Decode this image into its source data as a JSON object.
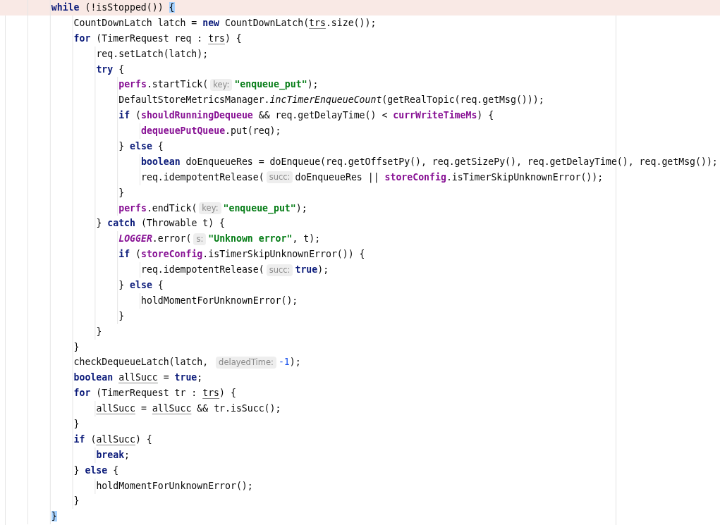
{
  "editor": {
    "lines": [
      {
        "current": true,
        "segments": [
          {
            "kind": "code",
            "tokens": [
              {
                "text": "    while",
                "kind": "kw"
              },
              {
                "text": " (!isStopped()) ",
                "kind": "plain"
              },
              {
                "text": "{",
                "kind": "brace"
              }
            ]
          }
        ]
      },
      {
        "current": false,
        "segments": [
          {
            "kind": "code",
            "tokens": [
              {
                "text": "        CountDownLatch latch = ",
                "kind": "plain"
              },
              {
                "text": "new",
                "kind": "kw"
              },
              {
                "text": " CountDownLatch(",
                "kind": "plain"
              },
              {
                "text": "trs",
                "kind": "var"
              },
              {
                "text": ".size());",
                "kind": "plain"
              }
            ]
          }
        ]
      },
      {
        "current": false,
        "segments": [
          {
            "kind": "code",
            "tokens": [
              {
                "text": "        for",
                "kind": "kw"
              },
              {
                "text": " (TimerRequest req : ",
                "kind": "plain"
              },
              {
                "text": "trs",
                "kind": "var"
              },
              {
                "text": ") {",
                "kind": "plain"
              }
            ]
          }
        ]
      },
      {
        "current": false,
        "segments": [
          {
            "kind": "code",
            "tokens": [
              {
                "text": "            req.setLatch(latch);",
                "kind": "plain"
              }
            ]
          }
        ]
      },
      {
        "current": false,
        "segments": [
          {
            "kind": "code",
            "tokens": [
              {
                "text": "            try",
                "kind": "kw"
              },
              {
                "text": " {",
                "kind": "plain"
              }
            ]
          }
        ]
      },
      {
        "current": false,
        "segments": [
          {
            "kind": "code",
            "tokens": [
              {
                "text": "                perfs",
                "kind": "field"
              },
              {
                "text": ".startTick(",
                "kind": "plain"
              }
            ]
          },
          {
            "kind": "hint",
            "text": "key:"
          },
          {
            "kind": "code",
            "tokens": [
              {
                "text": "\"enqueue_put\"",
                "kind": "str"
              },
              {
                "text": ");",
                "kind": "plain"
              }
            ]
          }
        ]
      },
      {
        "current": false,
        "segments": [
          {
            "kind": "code",
            "tokens": [
              {
                "text": "                DefaultStoreMetricsManager.",
                "kind": "plain"
              },
              {
                "text": "incTimerEnqueueCount",
                "kind": "static"
              },
              {
                "text": "(getRealTopic(req.getMsg()));",
                "kind": "plain"
              }
            ]
          }
        ]
      },
      {
        "current": false,
        "segments": [
          {
            "kind": "code",
            "tokens": [
              {
                "text": "                if",
                "kind": "kw"
              },
              {
                "text": " (",
                "kind": "plain"
              },
              {
                "text": "shouldRunningDequeue",
                "kind": "field"
              },
              {
                "text": " && req.getDelayTime() < ",
                "kind": "plain"
              },
              {
                "text": "currWriteTimeMs",
                "kind": "field"
              },
              {
                "text": ") {",
                "kind": "plain"
              }
            ]
          }
        ]
      },
      {
        "current": false,
        "segments": [
          {
            "kind": "code",
            "tokens": [
              {
                "text": "                    dequeuePutQueue",
                "kind": "field"
              },
              {
                "text": ".put(req);",
                "kind": "plain"
              }
            ]
          }
        ]
      },
      {
        "current": false,
        "segments": [
          {
            "kind": "code",
            "tokens": [
              {
                "text": "                } ",
                "kind": "plain"
              },
              {
                "text": "else",
                "kind": "kw"
              },
              {
                "text": " {",
                "kind": "plain"
              }
            ]
          }
        ]
      },
      {
        "current": false,
        "segments": [
          {
            "kind": "code",
            "tokens": [
              {
                "text": "                    boolean",
                "kind": "kw"
              },
              {
                "text": " doEnqueueRes = doEnqueue(req.getOffsetPy(), req.getSizePy(), req.getDelayTime(), req.getMsg());",
                "kind": "plain"
              }
            ]
          }
        ]
      },
      {
        "current": false,
        "segments": [
          {
            "kind": "code",
            "tokens": [
              {
                "text": "                    req.idempotentRelease(",
                "kind": "plain"
              }
            ]
          },
          {
            "kind": "hint",
            "text": "succ:"
          },
          {
            "kind": "code",
            "tokens": [
              {
                "text": "doEnqueueRes || ",
                "kind": "plain"
              },
              {
                "text": "storeConfig",
                "kind": "field"
              },
              {
                "text": ".isTimerSkipUnknownError());",
                "kind": "plain"
              }
            ]
          }
        ]
      },
      {
        "current": false,
        "segments": [
          {
            "kind": "code",
            "tokens": [
              {
                "text": "                }",
                "kind": "plain"
              }
            ]
          }
        ]
      },
      {
        "current": false,
        "segments": [
          {
            "kind": "code",
            "tokens": [
              {
                "text": "                perfs",
                "kind": "field"
              },
              {
                "text": ".endTick(",
                "kind": "plain"
              }
            ]
          },
          {
            "kind": "hint",
            "text": "key:"
          },
          {
            "kind": "code",
            "tokens": [
              {
                "text": "\"enqueue_put\"",
                "kind": "str"
              },
              {
                "text": ");",
                "kind": "plain"
              }
            ]
          }
        ]
      },
      {
        "current": false,
        "segments": [
          {
            "kind": "code",
            "tokens": [
              {
                "text": "            } ",
                "kind": "plain"
              },
              {
                "text": "catch",
                "kind": "kw"
              },
              {
                "text": " (Throwable t) {",
                "kind": "plain"
              }
            ]
          }
        ]
      },
      {
        "current": false,
        "segments": [
          {
            "kind": "code",
            "tokens": [
              {
                "text": "                LOGGER",
                "kind": "staticfield"
              },
              {
                "text": ".error(",
                "kind": "plain"
              }
            ]
          },
          {
            "kind": "hint",
            "text": "s:"
          },
          {
            "kind": "code",
            "tokens": [
              {
                "text": "\"Unknown error\"",
                "kind": "str"
              },
              {
                "text": ", t);",
                "kind": "plain"
              }
            ]
          }
        ]
      },
      {
        "current": false,
        "segments": [
          {
            "kind": "code",
            "tokens": [
              {
                "text": "                if",
                "kind": "kw"
              },
              {
                "text": " (",
                "kind": "plain"
              },
              {
                "text": "storeConfig",
                "kind": "field"
              },
              {
                "text": ".isTimerSkipUnknownError()) {",
                "kind": "plain"
              }
            ]
          }
        ]
      },
      {
        "current": false,
        "segments": [
          {
            "kind": "code",
            "tokens": [
              {
                "text": "                    req.idempotentRelease(",
                "kind": "plain"
              }
            ]
          },
          {
            "kind": "hint",
            "text": "succ:"
          },
          {
            "kind": "code",
            "tokens": [
              {
                "text": "true",
                "kind": "kw"
              },
              {
                "text": ");",
                "kind": "plain"
              }
            ]
          }
        ]
      },
      {
        "current": false,
        "segments": [
          {
            "kind": "code",
            "tokens": [
              {
                "text": "                } ",
                "kind": "plain"
              },
              {
                "text": "else",
                "kind": "kw"
              },
              {
                "text": " {",
                "kind": "plain"
              }
            ]
          }
        ]
      },
      {
        "current": false,
        "segments": [
          {
            "kind": "code",
            "tokens": [
              {
                "text": "                    holdMomentForUnknownError();",
                "kind": "plain"
              }
            ]
          }
        ]
      },
      {
        "current": false,
        "segments": [
          {
            "kind": "code",
            "tokens": [
              {
                "text": "                }",
                "kind": "plain"
              }
            ]
          }
        ]
      },
      {
        "current": false,
        "segments": [
          {
            "kind": "code",
            "tokens": [
              {
                "text": "            }",
                "kind": "plain"
              }
            ]
          }
        ]
      },
      {
        "current": false,
        "segments": [
          {
            "kind": "code",
            "tokens": [
              {
                "text": "        }",
                "kind": "plain"
              }
            ]
          }
        ]
      },
      {
        "current": false,
        "segments": [
          {
            "kind": "code",
            "tokens": [
              {
                "text": "        checkDequeueLatch(latch, ",
                "kind": "plain"
              }
            ]
          },
          {
            "kind": "hint",
            "text": "delayedTime:"
          },
          {
            "kind": "code",
            "tokens": [
              {
                "text": "-1",
                "kind": "num"
              },
              {
                "text": ");",
                "kind": "plain"
              }
            ]
          }
        ]
      },
      {
        "current": false,
        "segments": [
          {
            "kind": "code",
            "tokens": [
              {
                "text": "        boolean ",
                "kind": "kw"
              },
              {
                "text": "allSucc",
                "kind": "varwarn"
              },
              {
                "text": " = ",
                "kind": "plain"
              },
              {
                "text": "true",
                "kind": "kw"
              },
              {
                "text": ";",
                "kind": "plain"
              }
            ]
          }
        ]
      },
      {
        "current": false,
        "segments": [
          {
            "kind": "code",
            "tokens": [
              {
                "text": "        for",
                "kind": "kw"
              },
              {
                "text": " (TimerRequest tr : ",
                "kind": "plain"
              },
              {
                "text": "trs",
                "kind": "var"
              },
              {
                "text": ") {",
                "kind": "plain"
              }
            ]
          }
        ]
      },
      {
        "current": false,
        "segments": [
          {
            "kind": "code",
            "tokens": [
              {
                "text": "            allSucc",
                "kind": "var"
              },
              {
                "text": " = ",
                "kind": "plain"
              },
              {
                "text": "allSucc",
                "kind": "var"
              },
              {
                "text": " && tr.isSucc();",
                "kind": "plain"
              }
            ]
          }
        ]
      },
      {
        "current": false,
        "segments": [
          {
            "kind": "code",
            "tokens": [
              {
                "text": "        }",
                "kind": "plain"
              }
            ]
          }
        ]
      },
      {
        "current": false,
        "segments": [
          {
            "kind": "code",
            "tokens": [
              {
                "text": "        if",
                "kind": "kw"
              },
              {
                "text": " (",
                "kind": "plain"
              },
              {
                "text": "allSucc",
                "kind": "var"
              },
              {
                "text": ") {",
                "kind": "plain"
              }
            ]
          }
        ]
      },
      {
        "current": false,
        "segments": [
          {
            "kind": "code",
            "tokens": [
              {
                "text": "            break",
                "kind": "kw"
              },
              {
                "text": ";",
                "kind": "plain"
              }
            ]
          }
        ]
      },
      {
        "current": false,
        "segments": [
          {
            "kind": "code",
            "tokens": [
              {
                "text": "        } ",
                "kind": "plain"
              },
              {
                "text": "else",
                "kind": "kw"
              },
              {
                "text": " {",
                "kind": "plain"
              }
            ]
          }
        ]
      },
      {
        "current": false,
        "segments": [
          {
            "kind": "code",
            "tokens": [
              {
                "text": "            holdMomentForUnknownError();",
                "kind": "plain"
              }
            ]
          }
        ]
      },
      {
        "current": false,
        "segments": [
          {
            "kind": "code",
            "tokens": [
              {
                "text": "        }",
                "kind": "plain"
              }
            ]
          }
        ]
      },
      {
        "current": false,
        "segments": [
          {
            "kind": "code",
            "tokens": [
              {
                "text": "    }",
                "kind": "brace"
              }
            ]
          }
        ]
      }
    ]
  }
}
